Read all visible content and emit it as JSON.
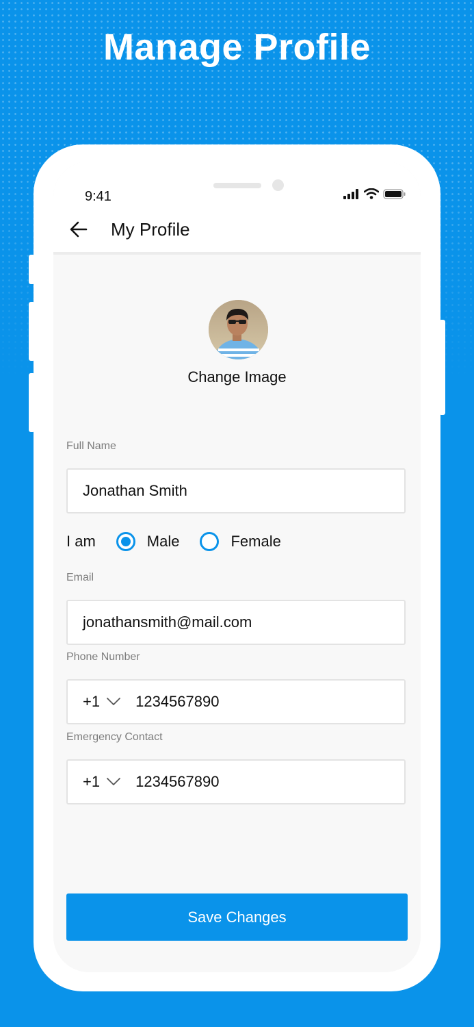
{
  "hero": {
    "title": "Manage Profile"
  },
  "status_bar": {
    "time": "9:41",
    "icons": [
      "signal-icon",
      "wifi-icon",
      "battery-icon"
    ]
  },
  "header": {
    "title": "My Profile",
    "back_icon": "arrow-left-icon"
  },
  "profile": {
    "change_image_label": "Change Image"
  },
  "form": {
    "full_name": {
      "label": "Full Name",
      "value": "Jonathan Smith"
    },
    "gender": {
      "label": "I am",
      "options": [
        "Male",
        "Female"
      ],
      "selected": "Male"
    },
    "email": {
      "label": "Email",
      "value": "jonathansmith@mail.com"
    },
    "phone": {
      "label": "Phone Number",
      "country_code": "+1",
      "value": "1234567890"
    },
    "emergency": {
      "label": "Emergency Contact",
      "country_code": "+1",
      "value": "1234567890"
    }
  },
  "actions": {
    "save_label": "Save Changes"
  },
  "colors": {
    "accent": "#0a93ea",
    "background": "#0a93ea",
    "screen": "#f8f8f8"
  }
}
